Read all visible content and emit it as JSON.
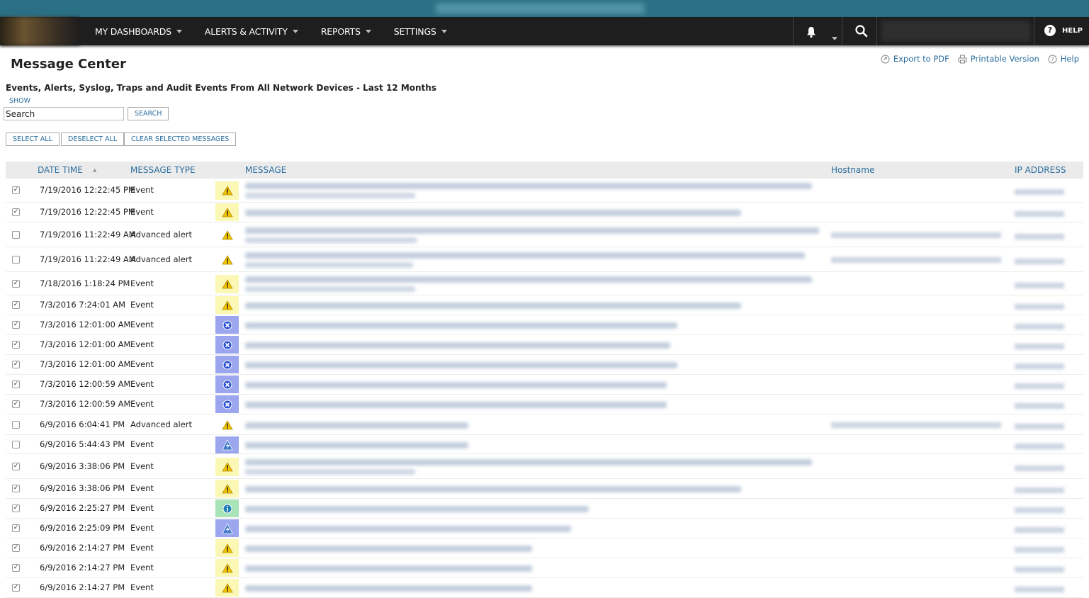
{
  "nav": {
    "items": [
      {
        "label": "MY DASHBOARDS"
      },
      {
        "label": "ALERTS & ACTIVITY"
      },
      {
        "label": "REPORTS"
      },
      {
        "label": "SETTINGS"
      }
    ],
    "help_label": "HELP",
    "help_glyph": "?"
  },
  "page": {
    "title": "Message Center",
    "subtitle": "Events, Alerts, Syslog, Traps and Audit Events From All Network Devices - Last 12 Months",
    "show_label": "SHOW",
    "links": {
      "export_pdf": "Export to PDF",
      "printable": "Printable Version",
      "help": "Help"
    }
  },
  "search": {
    "value": "Search",
    "button_label": "SEARCH"
  },
  "actions": {
    "select_all": "SELECT ALL",
    "deselect_all": "DESELECT ALL",
    "clear_selected": "CLEAR SELECTED MESSAGES"
  },
  "table": {
    "columns": {
      "date_time": "DATE TIME",
      "message_type": "MESSAGE TYPE",
      "message": "MESSAGE",
      "hostname": "Hostname",
      "ip_address": "IP ADDRESS"
    },
    "rows": [
      {
        "checked": true,
        "date": "7/19/2016 12:22:45 PM",
        "type": "Event",
        "icon": "warning-icon"
      },
      {
        "checked": true,
        "date": "7/19/2016 12:22:45 PM",
        "type": "Event",
        "icon": "warning-icon"
      },
      {
        "checked": false,
        "date": "7/19/2016 11:22:49 AM",
        "type": "Advanced alert",
        "icon": "warning-icon"
      },
      {
        "checked": false,
        "date": "7/19/2016 11:22:49 AM",
        "type": "Advanced alert",
        "icon": "warning-icon"
      },
      {
        "checked": true,
        "date": "7/18/2016 1:18:24 PM",
        "type": "Event",
        "icon": "warning-icon"
      },
      {
        "checked": true,
        "date": "7/3/2016 7:24:01 AM",
        "type": "Event",
        "icon": "warning-icon"
      },
      {
        "checked": true,
        "date": "7/3/2016 12:01:00 AM",
        "type": "Event",
        "icon": "critical-icon"
      },
      {
        "checked": true,
        "date": "7/3/2016 12:01:00 AM",
        "type": "Event",
        "icon": "critical-icon"
      },
      {
        "checked": true,
        "date": "7/3/2016 12:01:00 AM",
        "type": "Event",
        "icon": "critical-icon"
      },
      {
        "checked": true,
        "date": "7/3/2016 12:00:59 AM",
        "type": "Event",
        "icon": "critical-icon"
      },
      {
        "checked": true,
        "date": "7/3/2016 12:00:59 AM",
        "type": "Event",
        "icon": "critical-icon"
      },
      {
        "checked": false,
        "date": "6/9/2016 6:04:41 PM",
        "type": "Advanced alert",
        "icon": "warning-icon"
      },
      {
        "checked": false,
        "date": "6/9/2016 5:44:43 PM",
        "type": "Event",
        "icon": "network-icon"
      },
      {
        "checked": true,
        "date": "6/9/2016 3:38:06 PM",
        "type": "Event",
        "icon": "warning-icon"
      },
      {
        "checked": true,
        "date": "6/9/2016 3:38:06 PM",
        "type": "Event",
        "icon": "warning-icon"
      },
      {
        "checked": true,
        "date": "6/9/2016 2:25:27 PM",
        "type": "Event",
        "icon": "info-icon"
      },
      {
        "checked": true,
        "date": "6/9/2016 2:25:09 PM",
        "type": "Event",
        "icon": "network-icon"
      },
      {
        "checked": true,
        "date": "6/9/2016 2:14:27 PM",
        "type": "Event",
        "icon": "warning-icon"
      },
      {
        "checked": true,
        "date": "6/9/2016 2:14:27 PM",
        "type": "Event",
        "icon": "warning-icon"
      },
      {
        "checked": true,
        "date": "6/9/2016 2:14:27 PM",
        "type": "Event",
        "icon": "warning-icon"
      }
    ]
  },
  "colors": {
    "header_strip": "#2a6f84",
    "navbar": "#1e1e1e",
    "link": "#2c6e9e",
    "warning_bg": "#fbf7b4",
    "critical_bg": "#9ba6ee",
    "info_bg": "#a9e3b8"
  }
}
